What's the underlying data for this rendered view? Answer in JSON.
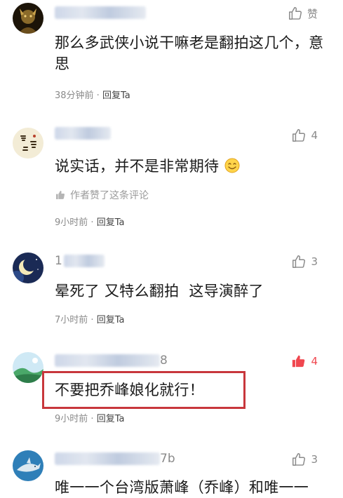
{
  "comments": [
    {
      "username_visible": "",
      "username_suffix": "",
      "like_label": "赞",
      "like_count": "",
      "liked": false,
      "content": "那么多武侠小说干嘛老是翻拍这几个，意思",
      "time": "38分钟前",
      "reply": "回复Ta",
      "avatar_icon": "warrior-avatar-icon"
    },
    {
      "username_visible": "",
      "username_suffix": "",
      "like_label": "",
      "like_count": "4",
      "liked": false,
      "content": "说实话，并不是非常期待",
      "emoji": "smiley-emoji-icon",
      "author_liked": "作者赞了这条评论",
      "time": "9小时前",
      "reply": "回复Ta",
      "avatar_icon": "calligraphy-avatar-icon"
    },
    {
      "username_visible": "1",
      "username_suffix": "",
      "like_label": "",
      "like_count": "3",
      "liked": false,
      "content": "晕死了 又特么翻拍  这导演醉了",
      "time": "7小时前",
      "reply": "回复Ta",
      "avatar_icon": "moon-avatar-icon"
    },
    {
      "username_visible": "",
      "username_suffix": "8",
      "like_label": "",
      "like_count": "4",
      "liked": true,
      "content": "不要把乔峰娘化就行！",
      "time": "9小时前",
      "reply": "回复Ta",
      "avatar_icon": "landscape-avatar-icon",
      "highlighted": true
    },
    {
      "username_visible": "",
      "username_suffix": "7b",
      "like_label": "",
      "like_count": "3",
      "liked": false,
      "content": "唯一一个台湾版萧峰（乔峰）和唯一一",
      "time": "",
      "reply": "",
      "avatar_icon": "shark-avatar-icon"
    }
  ],
  "meta_separator": " · ",
  "colors": {
    "accent_red": "#f0474f",
    "highlight_border": "#c8373c",
    "meta_gray": "#8a8a8a"
  }
}
